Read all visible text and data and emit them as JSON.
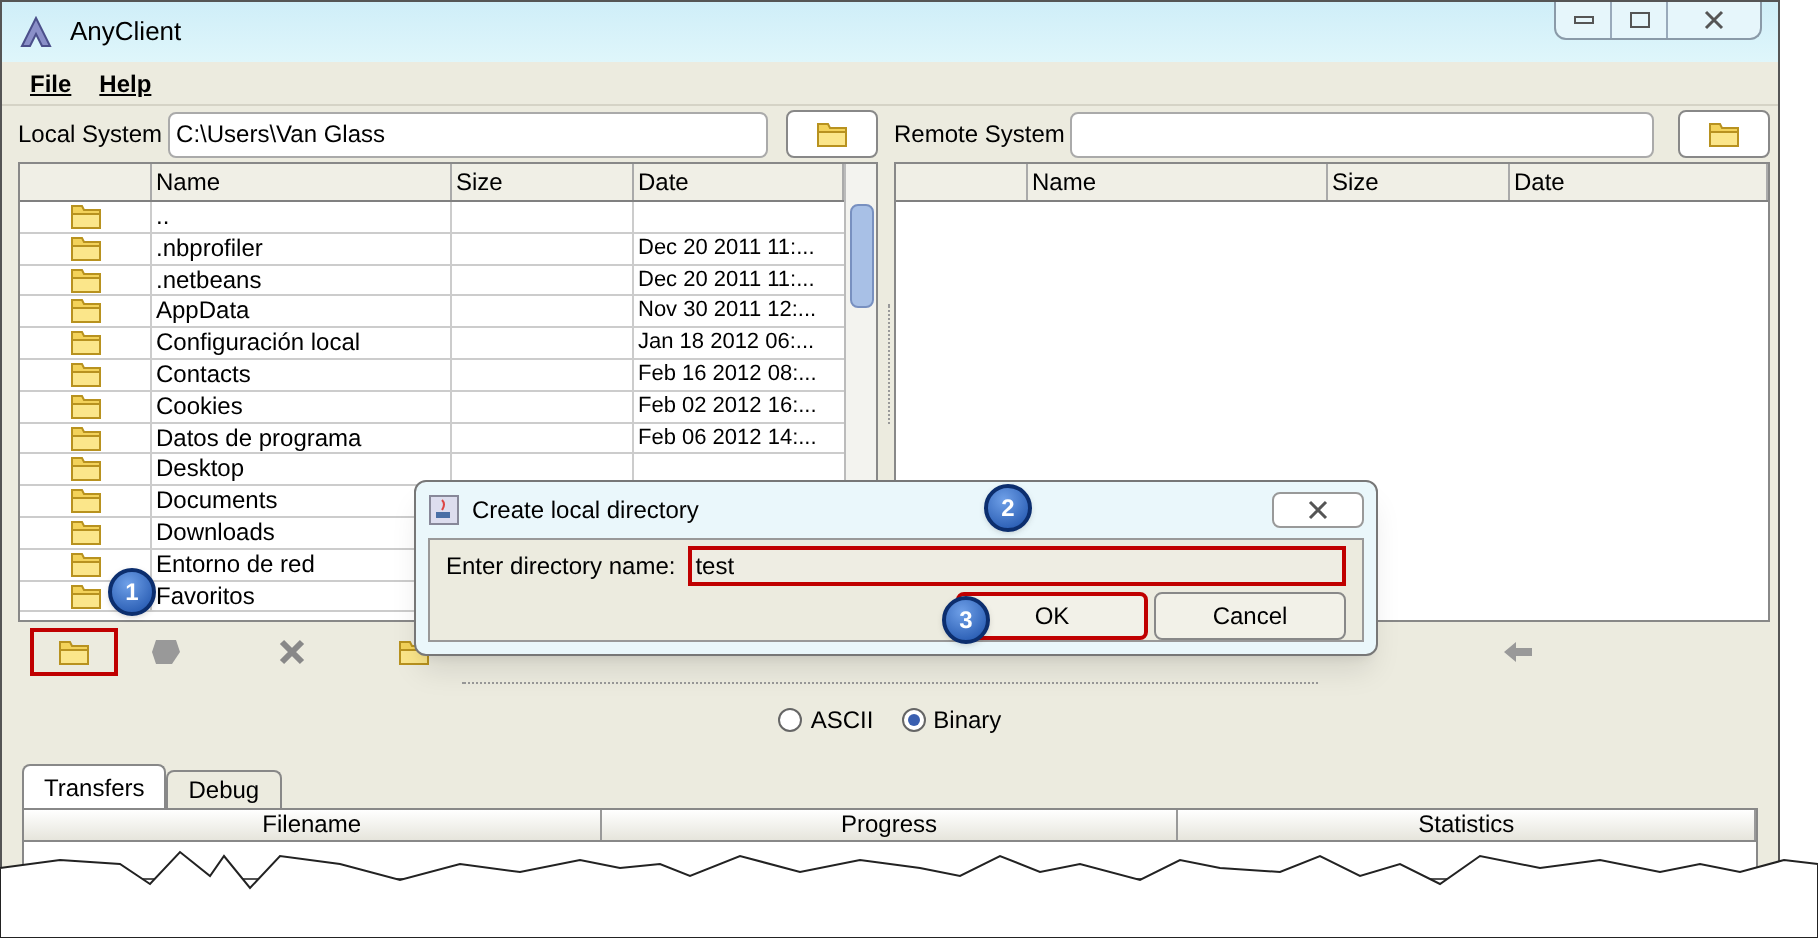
{
  "window": {
    "title": "AnyClient"
  },
  "menu": [
    "File",
    "Help"
  ],
  "local": {
    "label": "Local System",
    "path": "C:\\Users\\Van Glass",
    "columns": [
      "Name",
      "Size",
      "Date"
    ],
    "rows": [
      {
        "name": ".."
      },
      {
        "name": ".nbprofiler",
        "date": "Dec 20 2011 11:..."
      },
      {
        "name": ".netbeans",
        "date": "Dec 20 2011 11:..."
      },
      {
        "name": "AppData",
        "date": "Nov 30 2011 12:..."
      },
      {
        "name": "Configuración local",
        "date": "Jan 18 2012 06:..."
      },
      {
        "name": "Contacts",
        "date": "Feb 16 2012 08:..."
      },
      {
        "name": "Cookies",
        "date": "Feb 02 2012 16:..."
      },
      {
        "name": "Datos de programa",
        "date": "Feb 06 2012 14:..."
      },
      {
        "name": "Desktop"
      },
      {
        "name": "Documents"
      },
      {
        "name": "Downloads"
      },
      {
        "name": "Entorno de red"
      },
      {
        "name": "Favoritos"
      }
    ]
  },
  "remote": {
    "label": "Remote System",
    "columns": [
      "Name",
      "Size",
      "Date"
    ]
  },
  "dialog": {
    "title": "Create local directory",
    "label": "Enter directory name:",
    "value": "test",
    "buttons": [
      {
        "label": "OK",
        "highlighted": true
      },
      {
        "label": "Cancel",
        "highlighted": false
      }
    ]
  },
  "callouts": [
    "1",
    "2",
    "3"
  ],
  "transfer_mode": [
    {
      "label": "ASCII",
      "selected": false
    },
    {
      "label": "Binary",
      "selected": true
    }
  ],
  "tabs": [
    {
      "label": "Transfers",
      "selected": true
    },
    {
      "label": "Debug",
      "selected": false
    }
  ],
  "transfers": {
    "columns": [
      "Filename",
      "Progress",
      "Statistics"
    ]
  }
}
